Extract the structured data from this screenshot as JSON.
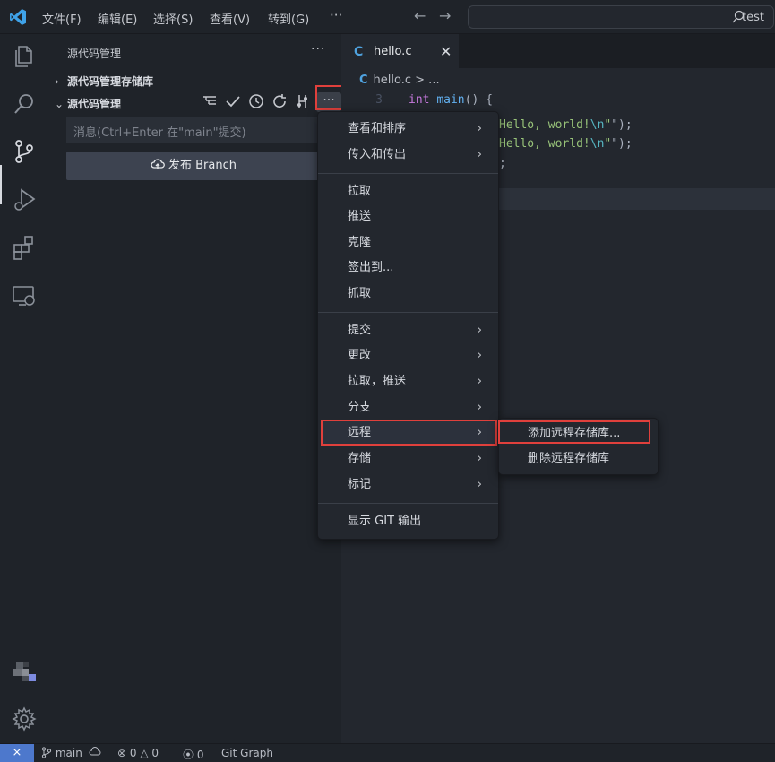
{
  "titlebar": {
    "menus": [
      "文件(F)",
      "编辑(E)",
      "选择(S)",
      "查看(V)",
      "转到(G)"
    ],
    "more": "···",
    "search_text": "test"
  },
  "sidebar": {
    "title": "源代码管理",
    "more": "···",
    "section_repos": "源代码管理存储库",
    "section_scm": "源代码管理",
    "more_button": "···",
    "commit_placeholder": "消息(Ctrl+Enter 在\"main\"提交)",
    "publish_label": "发布 Branch"
  },
  "editor": {
    "tab_icon": "C",
    "tab_name": "hello.c",
    "tab_close": "✕",
    "breadcrumb_file": "hello.c",
    "breadcrumb_rest": "> ...",
    "line_number": "3",
    "code": {
      "l1_kw": "int",
      "l1_fn": "main",
      "l1_rest": "() {",
      "l2_str": "Hello, world!",
      "l2_esc": "\\n",
      "l2_end": "\");",
      "l3_str": "Hello, world!",
      "l3_esc": "\\n",
      "l3_end": "\");",
      "l4": ";"
    }
  },
  "menu": {
    "items": [
      {
        "label": "查看和排序",
        "arrow": "›"
      },
      {
        "label": "传入和传出",
        "arrow": "›"
      },
      {
        "label": "拉取"
      },
      {
        "label": "推送"
      },
      {
        "label": "克隆"
      },
      {
        "label": "签出到..."
      },
      {
        "label": "抓取"
      },
      {
        "label": "提交",
        "arrow": "›"
      },
      {
        "label": "更改",
        "arrow": "›"
      },
      {
        "label": "拉取，推送",
        "arrow": "›"
      },
      {
        "label": "分支",
        "arrow": "›"
      },
      {
        "label": "远程",
        "arrow": "›"
      },
      {
        "label": "存储",
        "arrow": "›"
      },
      {
        "label": "标记",
        "arrow": "›"
      },
      {
        "label": "显示 GIT 输出"
      }
    ]
  },
  "submenu": {
    "items": [
      "添加远程存储库...",
      "删除远程存储库"
    ]
  },
  "statusbar": {
    "remote_icon": "⨯",
    "branch": "main",
    "errors": "0",
    "warnings": "0",
    "ports": "0",
    "git_graph": "Git Graph"
  },
  "colors": {
    "accent": "#4d78cc",
    "highlight_box": "#e0403c"
  }
}
